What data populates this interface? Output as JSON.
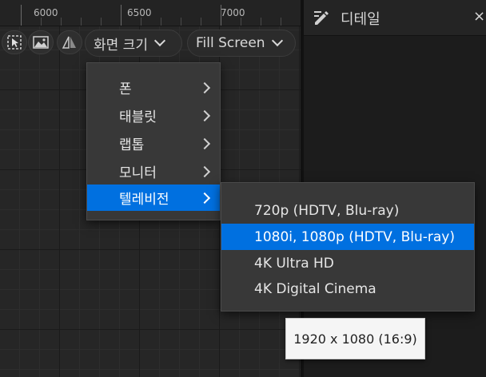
{
  "ruler": {
    "labels": [
      "6000",
      "6500",
      "7000"
    ]
  },
  "toolbar": {
    "icons": [
      "select-icon",
      "image-icon",
      "mirror-icon"
    ],
    "screen_size_label": "화면 크기",
    "fill_screen_label": "Fill Screen"
  },
  "device_menu": {
    "items": [
      {
        "label": "폰"
      },
      {
        "label": "태블릿"
      },
      {
        "label": "랩톱"
      },
      {
        "label": "모니터"
      },
      {
        "label": "텔레비전",
        "selected": true
      }
    ]
  },
  "tv_submenu": {
    "items": [
      {
        "label": "720p (HDTV, Blu-ray)"
      },
      {
        "label": "1080i, 1080p (HDTV, Blu-ray)",
        "selected": true
      },
      {
        "label": "4K Ultra HD"
      },
      {
        "label": "4K Digital Cinema"
      }
    ]
  },
  "tooltip": {
    "text": "1920 x 1080 (16:9)"
  },
  "details_panel": {
    "title": "디테일",
    "close_glyph": "×"
  },
  "colors": {
    "selection": "#0070e0",
    "menu_bg": "#383838",
    "background": "#1b1b1b"
  }
}
